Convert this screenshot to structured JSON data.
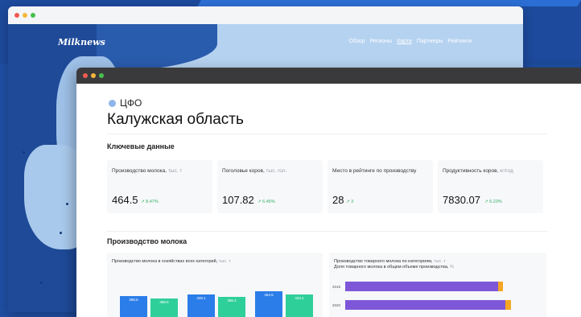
{
  "colors": {
    "accent_blue": "#2b7de9",
    "accent_green": "#2fcf9a",
    "purple": "#7e57d8",
    "orange": "#f5a623",
    "positive": "#33b065"
  },
  "back_window": {
    "logo": "Milknews",
    "nav": [
      {
        "label": "Обзор",
        "active": false
      },
      {
        "label": "Регионы",
        "active": false
      },
      {
        "label": "Карта",
        "active": true
      },
      {
        "label": "Партнеры",
        "active": false
      },
      {
        "label": "Рейтинги",
        "active": false
      }
    ]
  },
  "front_window": {
    "district": "ЦФО",
    "region_title": "Калужская область",
    "key_data_heading": "Ключевые данные",
    "cards": [
      {
        "label": "Производство молока,",
        "unit": " тыс. т",
        "value": "464.5",
        "change": "↗ 8.47%"
      },
      {
        "label": "Поголовье коров,",
        "unit": " тыс. гол.",
        "value": "107.82",
        "change": "↗ 6.45%"
      },
      {
        "label": "Место в рейтинге по производству",
        "unit": "",
        "value": "28",
        "change": "↗ 3"
      },
      {
        "label": "Продуктивность коров,",
        "unit": " кг/год",
        "value": "7830.07",
        "change": "↗ 6.23%"
      }
    ],
    "milk_heading": "Производство молока",
    "chart_left": {
      "title": "Производство молока в хозяйствах всех категорий,",
      "unit": " тыс. т",
      "bars": [
        {
          "blue": "398.6",
          "green": "389.6"
        },
        {
          "blue": "428.1",
          "green": "396.4"
        },
        {
          "blue": "464.5",
          "green": "423.1"
        }
      ]
    },
    "chart_right": {
      "title_line1": "Производство товарного молока по категориям,",
      "title_line1_unit": " тыс. т",
      "title_line2": "Доля товарного молока в общем объеме производства,",
      "title_line2_unit": " %",
      "years": [
        "2019",
        "2020"
      ]
    }
  }
}
